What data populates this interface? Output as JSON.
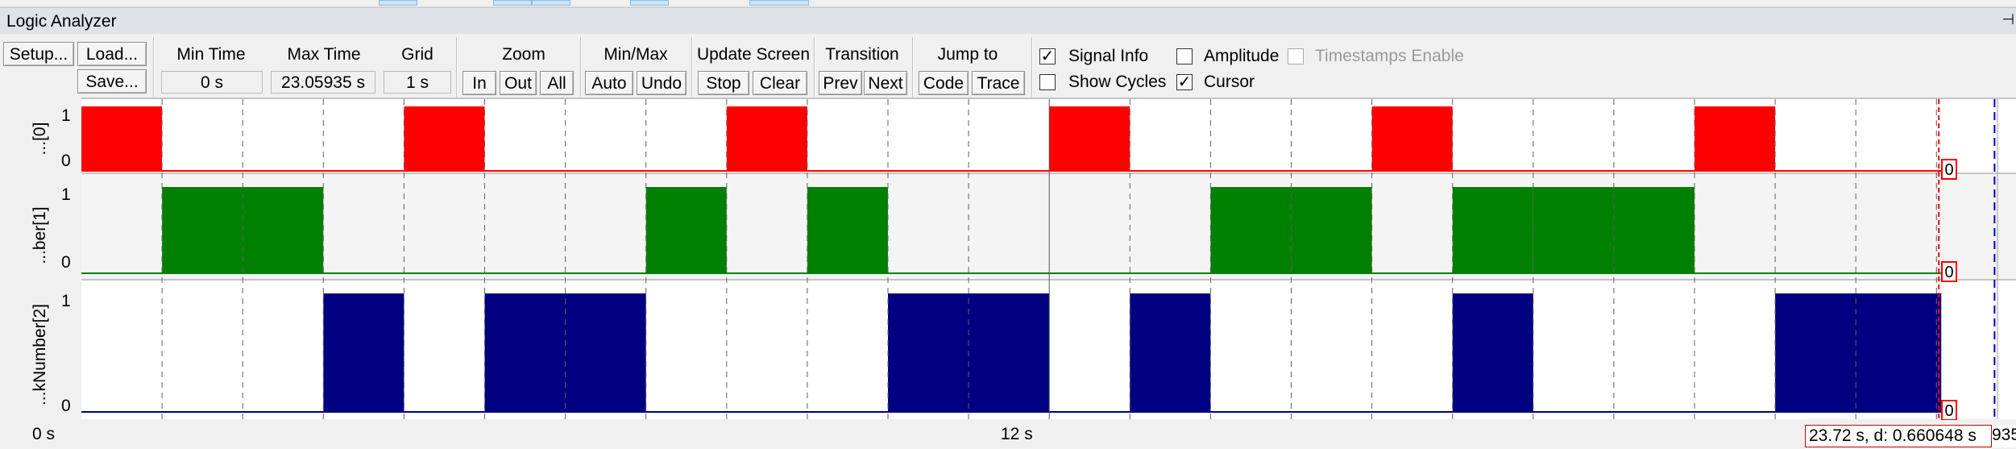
{
  "window": {
    "title": "Logic Analyzer",
    "pin_icon": "pin-icon"
  },
  "toolbar": {
    "setup": "Setup...",
    "load": "Load...",
    "save": "Save...",
    "min_time": {
      "label": "Min Time",
      "value": "0 s"
    },
    "max_time": {
      "label": "Max Time",
      "value": "23.05935 s"
    },
    "grid": {
      "label": "Grid",
      "value": "1 s"
    },
    "zoom": {
      "label": "Zoom",
      "in": "In",
      "out": "Out",
      "all": "All"
    },
    "minmax": {
      "label": "Min/Max",
      "auto": "Auto",
      "undo": "Undo"
    },
    "update": {
      "label": "Update Screen",
      "stop": "Stop",
      "clear": "Clear"
    },
    "transition": {
      "label": "Transition",
      "prev": "Prev",
      "next": "Next"
    },
    "jump": {
      "label": "Jump to",
      "code": "Code",
      "trace": "Trace"
    },
    "signal_info": {
      "label": "Signal Info",
      "checked": true
    },
    "amplitude": {
      "label": "Amplitude",
      "checked": false
    },
    "timestamps": {
      "label": "Timestamps Enable",
      "checked": false,
      "enabled": false
    },
    "show_cycles": {
      "label": "Show Cycles",
      "checked": false
    },
    "cursor": {
      "label": "Cursor",
      "checked": true
    }
  },
  "signals": [
    {
      "name": "...[0]",
      "high": "1",
      "low": "0",
      "color": "#ff0000",
      "value": "0",
      "high_intervals": [
        [
          0,
          1
        ],
        [
          4,
          5
        ],
        [
          8,
          9
        ],
        [
          12,
          13
        ],
        [
          16,
          17
        ],
        [
          20,
          21
        ]
      ]
    },
    {
      "name": "...ber[1]",
      "high": "1",
      "low": "0",
      "color": "#008000",
      "value": "0",
      "high_intervals": [
        [
          1,
          3
        ],
        [
          7,
          8
        ],
        [
          9,
          10
        ],
        [
          14,
          16
        ],
        [
          17,
          18
        ],
        [
          18,
          20
        ]
      ]
    },
    {
      "name": "...kNumber[2]",
      "high": "1",
      "low": "0",
      "color": "#000080",
      "value": "0",
      "high_intervals": [
        [
          3,
          4
        ],
        [
          5,
          7
        ],
        [
          10,
          12
        ],
        [
          13,
          14
        ],
        [
          17,
          18
        ],
        [
          21,
          23.05935
        ]
      ]
    }
  ],
  "time_axis": {
    "start_label": "0 s",
    "mid_label": "12 s",
    "mid_value": 12
  },
  "cursor_info": {
    "text": "23.72 s,  d: 0.660648 s",
    "overflow_text": "935"
  },
  "colors": {
    "grid": "#606060",
    "cursor": "#ff0000",
    "marker": "#0000cc",
    "panel": "#ffffff",
    "panel_alt": "#f4f4f4"
  }
}
